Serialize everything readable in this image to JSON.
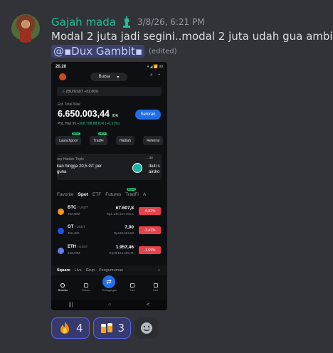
{
  "message": {
    "author": "Gajah mada",
    "timestamp": "3/8/26, 6:21 PM",
    "text": "Modal 2 juta jadi segini..modal 2 juta udah gua ambil",
    "mention": "@▪Dux Gambit▪",
    "edited_label": "(edited)"
  },
  "phone": {
    "time": "20.20",
    "status_right": "▾ ◢ 📶 90",
    "mode_label": "Bursa",
    "pair_search": "ZBU/USDT +52.66%",
    "balance_label": "Est. Total Nilai",
    "balance": "6.650.003,44",
    "balance_currency": "IDR",
    "deposit_label": "Setoran",
    "pnl_label": "PnL Hari Ini",
    "pnl_value": "+308.708,88 IDR (+6.37%)",
    "actions": [
      {
        "label": "Launchpool",
        "tag": "NEW"
      },
      {
        "label": "TradFi",
        "tag": "HOT"
      },
      {
        "label": "Hadiah",
        "tag": ""
      },
      {
        "label": "Referral",
        "tag": ""
      }
    ],
    "banner_title": "rop Hadiah Triple",
    "banner_text": "kan hingga 20,5 GT per",
    "banner_text2": "guna",
    "banner_badge": "...38",
    "banner_right": "Ikuti s",
    "banner_right2": "airdro",
    "market_tabs": [
      "Favorite",
      "Spot",
      "ETF",
      "Futures",
      "TradFi",
      "A"
    ],
    "market_tag": "30&Up",
    "rows": [
      {
        "sym": "BTC",
        "quote": "/ USDT",
        "vol": "352,98M",
        "price": "67.607,8",
        "idr": "Rp1.145.107.491,1",
        "chg": "-0.83%",
        "color": "#f7931a"
      },
      {
        "sym": "GT",
        "quote": "/ USDT",
        "vol": "356,49K",
        "price": "7,00",
        "idr": "Rp118.562,53",
        "chg": "-1.41%",
        "color": "#2354e6"
      },
      {
        "sym": "ETH",
        "quote": "/ USDT",
        "vol": "236,78M",
        "price": "1.957,46",
        "idr": "Rp33.154.469,71",
        "chg": "-1.69%",
        "color": "#627eea"
      }
    ],
    "square_tabs": [
      "Square",
      "Live",
      "Grup",
      "Pengumuman"
    ],
    "nav": [
      "Beranda",
      "Futures",
      "Perdagangan",
      "Earn",
      "Aset"
    ],
    "sysbar": [
      "|||",
      "○",
      "<"
    ]
  },
  "reactions": [
    {
      "emoji": "fire",
      "count": "4"
    },
    {
      "emoji": "beer-mugs",
      "count": "3"
    }
  ]
}
